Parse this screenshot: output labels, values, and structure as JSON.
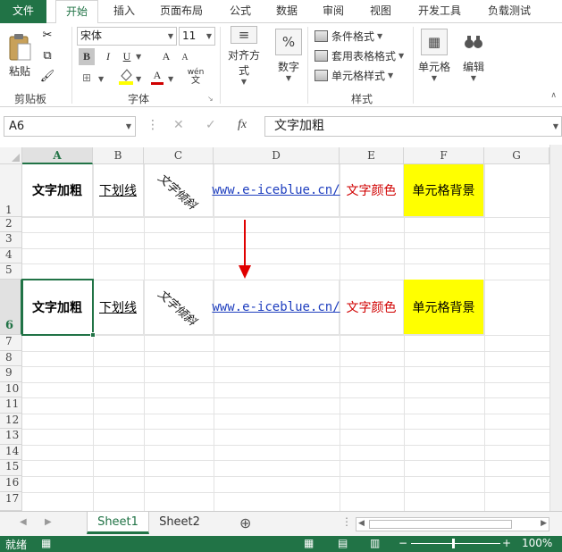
{
  "tabs": [
    "文件",
    "开始",
    "插入",
    "页面布局",
    "公式",
    "数据",
    "审阅",
    "视图",
    "开发工具",
    "负载测试"
  ],
  "ribbon": {
    "paste_label": "粘贴",
    "clipboard_label": "剪贴板",
    "font_name": "宋体",
    "font_size": "11",
    "font_group_label": "字体",
    "bold": "B",
    "italic": "I",
    "underline": "U",
    "grow_font": "A",
    "shrink_font": "A",
    "font_color": "A",
    "phonetic": "wén",
    "align_label": "对齐方式",
    "number_label": "数字",
    "number_icon": "%",
    "cond_format": "条件格式",
    "table_format": "套用表格格式",
    "cell_style": "单元格样式",
    "styles_label": "样式",
    "cells_label": "单元格",
    "edit_label": "编辑"
  },
  "formula_bar": {
    "name_box": "A6",
    "fx": "fx",
    "value": "文字加粗"
  },
  "columns": [
    "A",
    "B",
    "C",
    "D",
    "E",
    "F",
    "G"
  ],
  "rows": [
    "1",
    "2",
    "3",
    "4",
    "5",
    "6",
    "7",
    "8",
    "9",
    "10",
    "11",
    "12",
    "13",
    "14",
    "15",
    "16",
    "17"
  ],
  "cells": {
    "r1": {
      "a": "文字加粗",
      "b": "下划线",
      "c": "文字倾斜",
      "d": "www.e-iceblue.cn/",
      "e": "文字颜色",
      "f": "单元格背景"
    },
    "r6": {
      "a": "文字加粗",
      "b": "下划线",
      "c": "文字倾斜",
      "d": "www.e-iceblue.cn/",
      "e": "文字颜色",
      "f": "单元格背景"
    }
  },
  "sheets": [
    "Sheet1",
    "Sheet2"
  ],
  "add_sheet": "⊕",
  "status": {
    "ready": "就绪",
    "zoom": "100%"
  },
  "colors": {
    "accent": "#217346",
    "highlight": "#ffff00",
    "red_text": "#d00000",
    "link": "#1f3fbf",
    "arrow": "#e00000"
  }
}
